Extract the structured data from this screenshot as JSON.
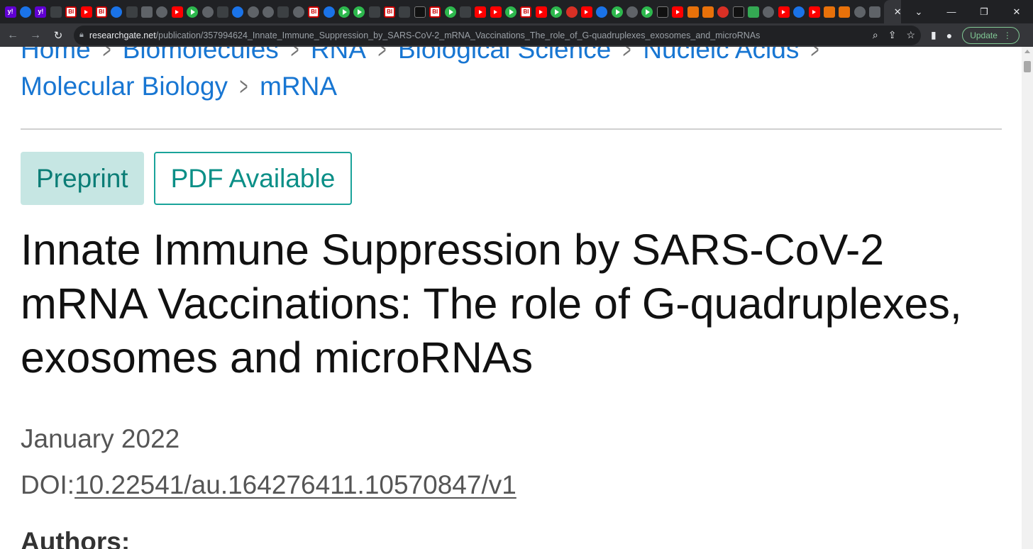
{
  "browser": {
    "tabs": {
      "favicons": [
        "yahoo-icon",
        "wave-icon",
        "yahoo-icon",
        "lit-icon",
        "bi-icon",
        "youtube-icon",
        "bi-icon",
        "wave-icon",
        "tab-icon",
        "image-icon",
        "globe-icon",
        "youtube-icon",
        "play-icon",
        "globe-icon",
        "tab-icon",
        "search-icon",
        "settings-icon",
        "google-icon",
        "lit-icon",
        "globe-icon",
        "bi-icon",
        "wave-icon",
        "play-icon",
        "play-icon",
        "tab-icon",
        "bi-icon",
        "lit-icon",
        "dark-icon",
        "bi-icon",
        "play-icon",
        "tab-icon",
        "youtube-icon",
        "youtube-icon",
        "play-icon",
        "bi-icon",
        "youtube-icon",
        "play-icon",
        "alert-icon",
        "youtube-icon",
        "search-icon",
        "play-icon",
        "globe-icon",
        "play-icon",
        "news-icon",
        "youtube-icon",
        "bookmark-icon",
        "bookmark-icon",
        "alert-icon",
        "dark-icon",
        "g-icon",
        "skull-icon",
        "youtube-icon",
        "shield-icon",
        "youtube-icon",
        "bookmark-icon",
        "bookmark-icon",
        "globe-icon",
        "image-icon"
      ],
      "active_close": "✕",
      "after_active": [
        "yahoo-icon",
        "alert-icon",
        "wave-icon",
        "globe-icon",
        "yahoo-icon"
      ],
      "new_tab": "+"
    },
    "window_controls": {
      "dropdown": "⌄",
      "minimize": "—",
      "restore": "❐",
      "close": "✕"
    },
    "address_bar": {
      "host": "researchgate.net",
      "path": "/publication/357994624_Innate_Immune_Suppression_by_SARS-CoV-2_mRNA_Vaccinations_The_role_of_G-quadruplexes_exosomes_and_microRNAs"
    },
    "update_label": "Update"
  },
  "breadcrumbs": {
    "line1": [
      "Home",
      "Biomolecules",
      "RNA",
      "Biological Science",
      "Nucleic Acids"
    ],
    "line2": [
      "Molecular Biology",
      "mRNA"
    ]
  },
  "badges": {
    "preprint": "Preprint",
    "pdf": "PDF Available"
  },
  "publication": {
    "title": "Innate Immune Suppression by SARS-CoV-2 mRNA Vaccinations: The role of G-quadruplexes, exosomes and microRNAs",
    "date": "January 2022",
    "doi_label": "DOI:",
    "doi_value": "10.22541/au.164276411.10570847/v1",
    "authors_heading": "Authors:"
  }
}
